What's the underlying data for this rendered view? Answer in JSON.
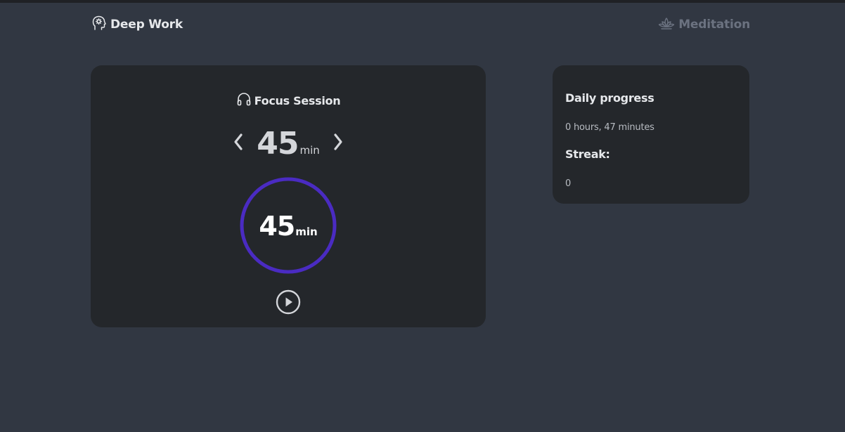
{
  "nav": {
    "left_label": "Deep Work",
    "left_icon": "brain-head-icon",
    "right_label": "Meditation",
    "right_icon": "lotus-icon"
  },
  "focus": {
    "title": "Focus Session",
    "title_icon": "headphones-icon",
    "duration_value": "45",
    "duration_unit": "min",
    "timer_value": "45",
    "timer_unit": "min",
    "timer_remaining_fraction": 1.0,
    "prev_icon": "chevron-left-icon",
    "next_icon": "chevron-right-icon",
    "play_icon": "play-circle-icon"
  },
  "progress": {
    "title": "Daily progress",
    "hours_text": "0 hours, 47 minutes",
    "streak_label": "Streak:",
    "streak_value": "0"
  },
  "colors": {
    "background": "#313742",
    "card": "#24272b",
    "ring": "#4a2bc2",
    "muted_text": "#6b7280"
  }
}
